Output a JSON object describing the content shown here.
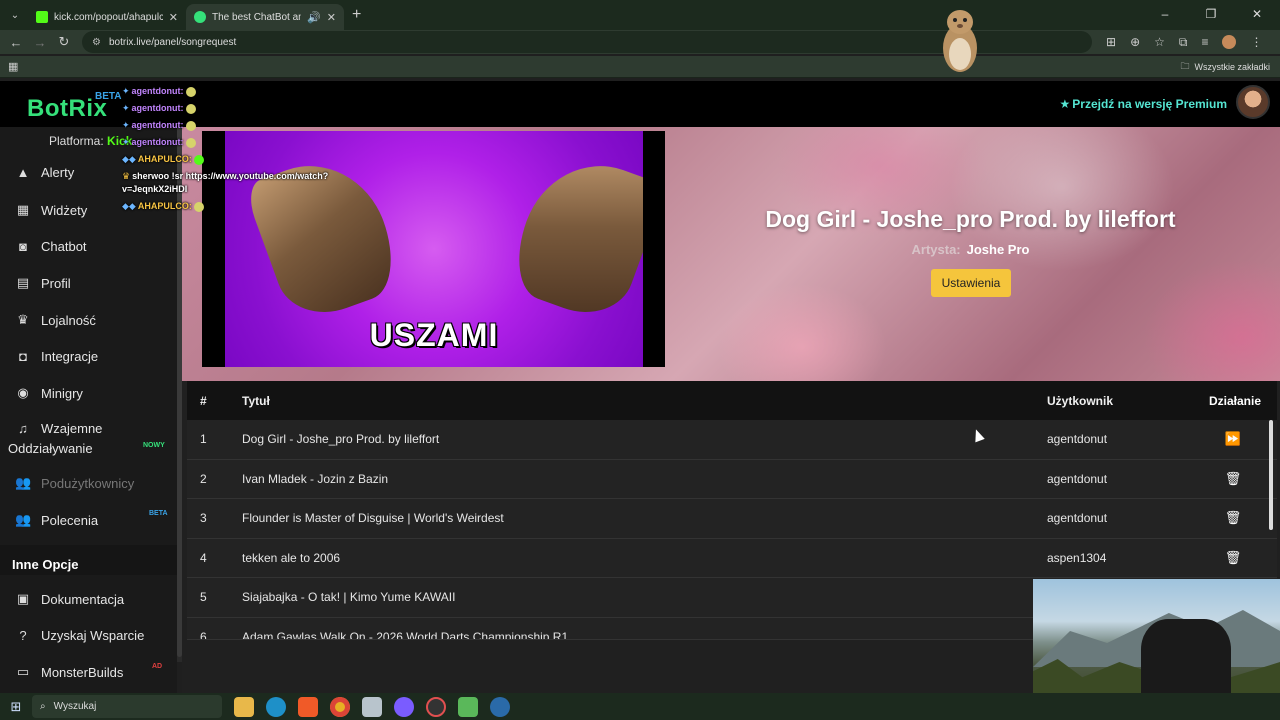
{
  "browser": {
    "tabs": [
      {
        "label": "kick.com/popout/ahapulco/ch...",
        "favicon_color": "#53fc18",
        "active": false
      },
      {
        "label": "The best ChatBot and Widg...",
        "favicon_color": "#35e07a",
        "active": true
      }
    ],
    "url": "botrix.live/panel/songrequest",
    "bookmarks_label": "Wszystkie zakładki"
  },
  "header": {
    "logo": "BotRix",
    "logo_badge": "BETA",
    "premium_label": "Przejdź na wersję Premium"
  },
  "sidebar": {
    "platform_label": "Platforma:",
    "platform_value": "Kick",
    "items": [
      {
        "label": "Alerty",
        "icon": "warning-icon"
      },
      {
        "label": "Widżety",
        "icon": "widgets-icon"
      },
      {
        "label": "Chatbot",
        "icon": "robot-icon"
      },
      {
        "label": "Profil",
        "icon": "id-card-icon"
      },
      {
        "label": "Lojalność",
        "icon": "trophy-icon"
      },
      {
        "label": "Integracje",
        "icon": "integration-icon"
      },
      {
        "label": "Minigry",
        "icon": "gamepad-icon"
      },
      {
        "label": "Wzajemne",
        "label2": "Oddziaływanie",
        "icon": "music-icon",
        "badge": "NOWY"
      },
      {
        "label": "Podużytkownicy",
        "icon": "users-icon"
      },
      {
        "label": "Polecenia",
        "icon": "users-icon",
        "badge": "BETA"
      }
    ],
    "other_title": "Inne Opcje",
    "other_items": [
      {
        "label": "Dokumentacja",
        "icon": "docs-icon"
      },
      {
        "label": "Uzyskaj Wsparcie",
        "icon": "question-icon"
      },
      {
        "label": "MonsterBuilds",
        "icon": "monitor-icon",
        "badge": "AD"
      }
    ]
  },
  "chat": [
    {
      "user": "agentdonut:",
      "color": "purple"
    },
    {
      "user": "agentdonut:",
      "color": "purple"
    },
    {
      "user": "agentdonut:",
      "color": "purple"
    },
    {
      "user": "agentdonut:",
      "color": "purple"
    },
    {
      "user": "AHAPULCO:",
      "color": "gold"
    },
    {
      "user": "sherwoo",
      "color": "white",
      "msg": "!sr https://www.youtube.com/watch?",
      "msg2": "v=JeqnkX2iHDI"
    },
    {
      "user": "AHAPULCO:",
      "color": "gold"
    }
  ],
  "player": {
    "video_caption": "USZAMI",
    "song_title": "Dog Girl - Joshe_pro Prod. by lileffort",
    "artist_label": "Artysta:",
    "artist_name": "Joshe Pro",
    "settings_button": "Ustawienia"
  },
  "queue": {
    "headers": {
      "num": "#",
      "title": "Tytuł",
      "user": "Użytkownik",
      "action": "Działanie"
    },
    "rows": [
      {
        "num": "1",
        "title": "Dog Girl - Joshe_pro Prod. by lileffort",
        "user": "agentdonut",
        "action": "skip"
      },
      {
        "num": "2",
        "title": "Ivan Mladek - Jozin z Bazin",
        "user": "agentdonut",
        "action": "delete"
      },
      {
        "num": "3",
        "title": "Flounder is Master of Disguise | World's Weirdest",
        "user": "agentdonut",
        "action": "delete"
      },
      {
        "num": "4",
        "title": "tekken ale to 2006",
        "user": "aspen1304",
        "action": "delete"
      },
      {
        "num": "5",
        "title": "Siajabajka - O tak! | Kimo Yume KAWAII",
        "user": "",
        "action": ""
      },
      {
        "num": "6",
        "title": "Adam Gawlas Walk On - 2026 World Darts Championship R1",
        "user": "",
        "action": ""
      }
    ]
  },
  "taskbar": {
    "search_placeholder": "Wyszukaj"
  }
}
